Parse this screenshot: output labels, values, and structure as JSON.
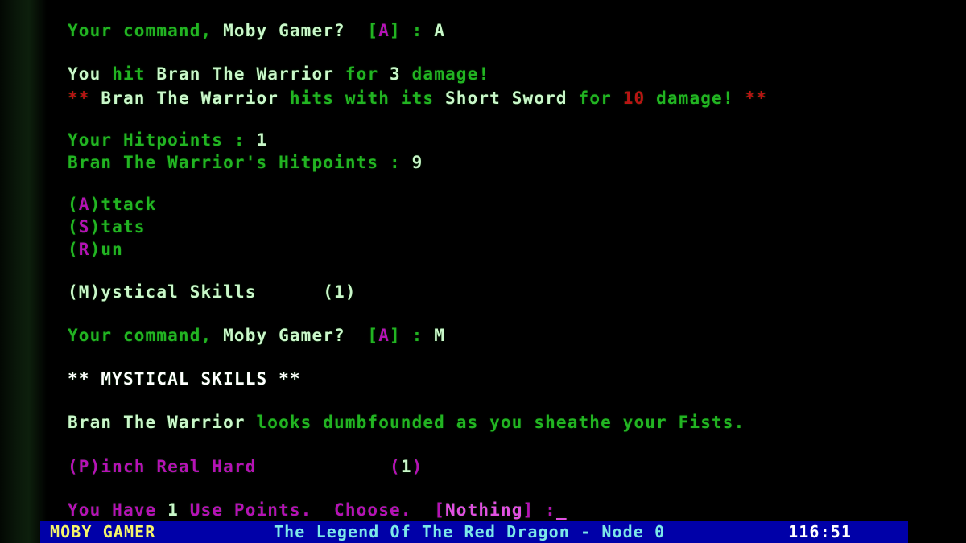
{
  "window": {
    "title": "The Legend Of The Red Dragon",
    "background_color": "#000000",
    "bezel_color": "#0d1f0c"
  },
  "palette": {
    "green": "#22b422",
    "bright_white": "#f2f2f2",
    "bright_green": "#caf7ca",
    "red": "#b81414",
    "magenta": "#b512b5",
    "bright_magenta": "#e050e0",
    "status_bar_blue": "#0000a8",
    "status_name_yellow": "#f5f56a",
    "status_title_cyan": "#7ce8e8"
  },
  "terminal": {
    "prompt_1": {
      "label": "Your command, ",
      "player": "Moby Gamer?",
      "bracket_open": "  [",
      "default_key": "A",
      "bracket_close": "] : ",
      "input": "A"
    },
    "combat": {
      "you_word": "You ",
      "hit_verb": "hit ",
      "monster": "Bran The Warrior",
      "for_word": " for ",
      "your_damage": "3",
      "damage_word": " damage!",
      "enemy_stars_left": "** ",
      "enemy_name": "Bran The Warrior",
      "enemy_verb": " hits with its ",
      "enemy_weapon": "Short Sword",
      "enemy_for": " for ",
      "enemy_damage": "10",
      "enemy_damage_word": " damage!",
      "enemy_stars_right": " **"
    },
    "hitpoints": {
      "your_label": "Your Hitpoints : ",
      "your_value": "1",
      "enemy_label": "Bran The Warrior's Hitpoints : ",
      "enemy_value": "9"
    },
    "menu": [
      {
        "paren_open": "(",
        "key": "A",
        "paren_close": ")",
        "rest": "ttack"
      },
      {
        "paren_open": "(",
        "key": "S",
        "paren_close": ")",
        "rest": "tats"
      },
      {
        "paren_open": "(",
        "key": "R",
        "paren_close": ")",
        "rest": "un"
      }
    ],
    "mystical_menu": {
      "text": "(M)ystical Skills",
      "count": "(1)"
    },
    "prompt_2": {
      "label": "Your command, ",
      "player": "Moby Gamer?",
      "bracket_open": "  [",
      "default_key": "A",
      "bracket_close": "] : ",
      "input": "M"
    },
    "skills_header": "** MYSTICAL SKILLS **",
    "dumbfounded": {
      "monster": "Bran The Warrior",
      "rest": " looks dumbfounded as you sheathe your Fists."
    },
    "skill_option": {
      "label": "(P)inch Real Hard",
      "paren_open": "(",
      "count": "1",
      "paren_close": ")"
    },
    "use_points": {
      "prefix": "You Have ",
      "points": "1",
      "middle": " Use Points.  Choose.  [",
      "choice": "Nothing",
      "suffix": "] :",
      "cursor": "_"
    }
  },
  "statusbar": {
    "user": "MOBY GAMER",
    "title": "The Legend Of The Red Dragon - Node 0",
    "timer": "116:51"
  }
}
